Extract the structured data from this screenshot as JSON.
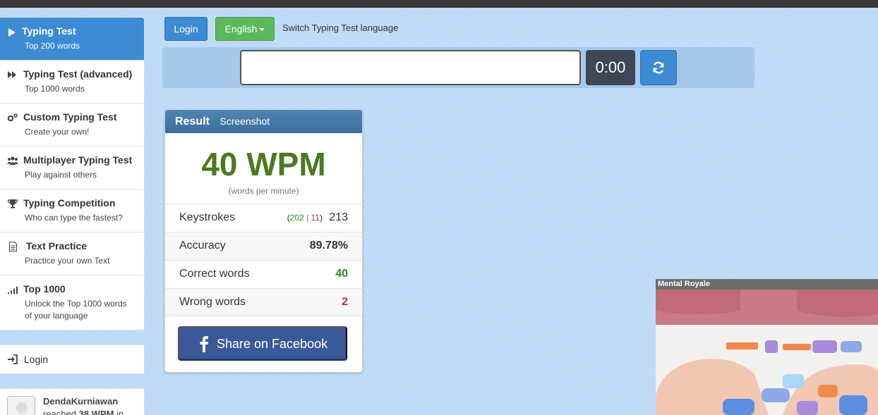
{
  "sidebar": {
    "items": [
      {
        "title": "Typing Test",
        "sub": "Top 200 words",
        "icon": "play-icon"
      },
      {
        "title": "Typing Test (advanced)",
        "sub": "Top 1000 words",
        "icon": "fast-forward-icon"
      },
      {
        "title": "Custom Typing Test",
        "sub": "Create your own!",
        "icon": "gears-icon"
      },
      {
        "title": "Multiplayer Typing Test",
        "sub": "Play against others",
        "icon": "users-icon"
      },
      {
        "title": "Typing Competition",
        "sub": "Who can type the fastest?",
        "icon": "trophy-icon"
      },
      {
        "title": "Text Practice",
        "sub": "Practice your own Text",
        "icon": "document-icon"
      },
      {
        "title": "Top 1000",
        "sub_line1": "Unlock the Top 1000 words",
        "sub_line2": "of your language",
        "icon": "signal-icon"
      }
    ],
    "login_label": "Login",
    "activity": {
      "name": "DendaKurniawan",
      "prefix": "reached",
      "wpm": "38 WPM",
      "suffix": "in"
    }
  },
  "toolbar": {
    "login_label": "Login",
    "language_label": "English",
    "language_hint": "Switch Typing Test language"
  },
  "typing": {
    "input_value": "",
    "timer": "0:00"
  },
  "result": {
    "title": "Result",
    "subtitle": "Screenshot",
    "wpm": "40 WPM",
    "wpm_unit": "(words per minute)",
    "keystrokes": {
      "label": "Keystrokes",
      "correct": "202",
      "separator": "|",
      "wrong": "11",
      "total": "213"
    },
    "accuracy": {
      "label": "Accuracy",
      "value": "89.78%"
    },
    "correct_words": {
      "label": "Correct words",
      "value": "40"
    },
    "wrong_words": {
      "label": "Wrong words",
      "value": "2"
    },
    "share_label": "Share on Facebook"
  },
  "ad": {
    "label": "Mental Royale"
  },
  "colors": {
    "accent_blue": "#3d8bd3",
    "language_green": "#5cb85c",
    "wpm_green": "#4a7a1f",
    "correct_green": "#2a8a2a",
    "wrong_red": "#c9302c",
    "facebook_blue": "#3b5998",
    "page_background": "#bcd9f7"
  }
}
